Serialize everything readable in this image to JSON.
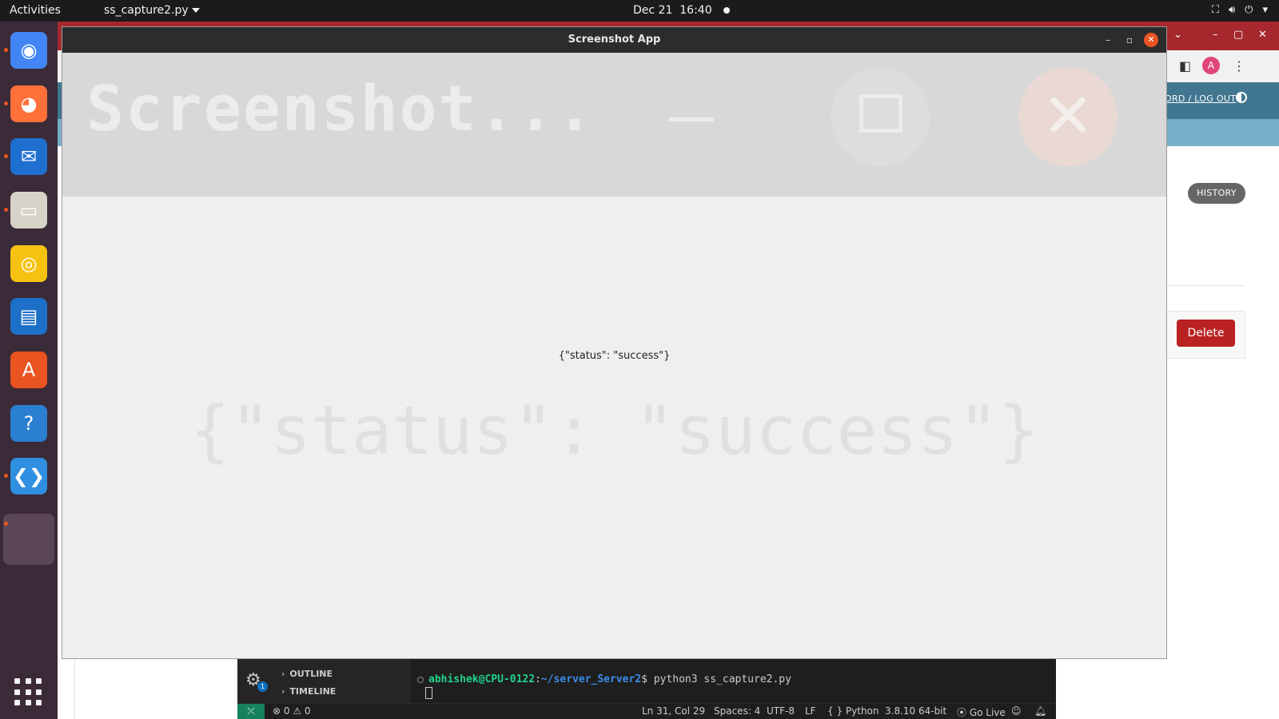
{
  "topbar": {
    "activities": "Activities",
    "app_menu": "ss_capture2.py",
    "date": "Dec 21",
    "time": "16:40",
    "tray_icons": [
      "network-icon",
      "volume-icon",
      "power-icon",
      "chevron-down-icon"
    ]
  },
  "dock": {
    "apps": [
      {
        "name": "chrome",
        "glyph": "◉",
        "color": "#4285f4"
      },
      {
        "name": "firefox",
        "glyph": "◕",
        "color": "#ff7139"
      },
      {
        "name": "thunderbird",
        "glyph": "✉",
        "color": "#1f6fd0"
      },
      {
        "name": "files",
        "glyph": "▭",
        "color": "#d8d3c8"
      },
      {
        "name": "rhythmbox",
        "glyph": "◎",
        "color": "#f5c211"
      },
      {
        "name": "libreoffice-writer",
        "glyph": "▤",
        "color": "#1e6fc8"
      },
      {
        "name": "app-center",
        "glyph": "A",
        "color": "#e95420"
      },
      {
        "name": "help",
        "glyph": "?",
        "color": "#2a7fd0"
      },
      {
        "name": "vscode",
        "glyph": "❮❯",
        "color": "#2f8fe0"
      }
    ]
  },
  "browser": {
    "account_initial": "A",
    "header_links": "ORD / LOG OUT",
    "history_label": "HISTORY",
    "delete_label": "Delete"
  },
  "vscode": {
    "badge": "1",
    "outline": "OUTLINE",
    "timeline": "TIMELINE",
    "prompt_user": "abhishek@CPU-0122",
    "prompt_path": "~/server_Server2",
    "command": "$ python3 ss_capture2.py",
    "status": {
      "problems": "⊗ 0 ⚠ 0",
      "position": "Ln 31, Col 29",
      "spaces": "Spaces: 4",
      "encoding": "UTF-8",
      "eol": "LF",
      "language": "{ } Python",
      "interpreter": "3.8.10 64-bit",
      "golive": "Go Live"
    }
  },
  "app": {
    "window_title": "Screenshot App",
    "banner_title": "Screenshot...",
    "status_text": "{\"status\": \"success\"}"
  }
}
